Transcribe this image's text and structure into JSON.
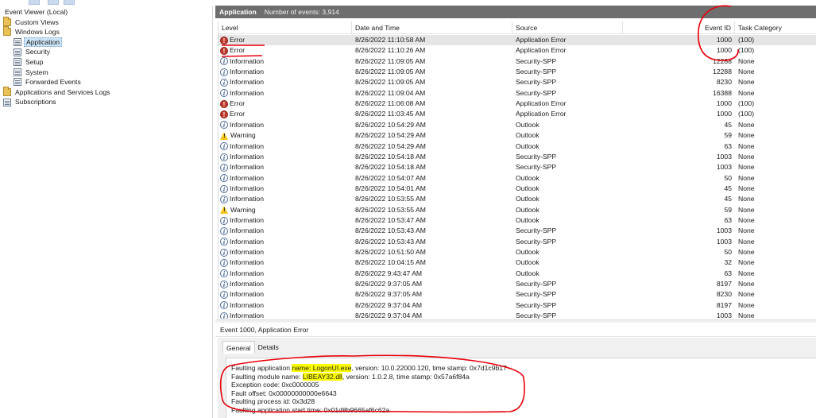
{
  "colors": {
    "header_bar": "#6e6e6e",
    "selection": "#cce4f7",
    "annotation": "#e8000a",
    "highlight": "#ffff00"
  },
  "tree": {
    "items": [
      {
        "label": "Event Viewer (Local)",
        "icon": "event-viewer-icon",
        "depth": 0
      },
      {
        "label": "Custom Views",
        "icon": "folder-icon",
        "depth": 1
      },
      {
        "label": "Windows Logs",
        "icon": "folder-icon",
        "depth": 1
      },
      {
        "label": "Application",
        "icon": "log-icon",
        "depth": 2,
        "selected": true
      },
      {
        "label": "Security",
        "icon": "log-icon",
        "depth": 2
      },
      {
        "label": "Setup",
        "icon": "log-icon",
        "depth": 2
      },
      {
        "label": "System",
        "icon": "log-icon",
        "depth": 2
      },
      {
        "label": "Forwarded Events",
        "icon": "log-icon",
        "depth": 2
      },
      {
        "label": "Applications and Services Logs",
        "icon": "folder-icon",
        "depth": 1
      },
      {
        "label": "Subscriptions",
        "icon": "log-icon",
        "depth": 1
      }
    ]
  },
  "header": {
    "title": "Application",
    "count": "Number of events: 3,914"
  },
  "columns": [
    "Level",
    "Date and Time",
    "Source",
    "Event ID",
    "Task Category"
  ],
  "events": [
    {
      "level": "Error",
      "icon": "error-icon",
      "date": "8/26/2022 11:10:58 AM",
      "source": "Application Error",
      "id": "1000",
      "task": "(100)",
      "selected": true
    },
    {
      "level": "Error",
      "icon": "error-icon",
      "date": "8/26/2022 11:10:26 AM",
      "source": "Application Error",
      "id": "1000",
      "task": "(100)"
    },
    {
      "level": "Information",
      "icon": "info-icon",
      "date": "8/26/2022 11:09:05 AM",
      "source": "Security-SPP",
      "id": "12288",
      "task": "None"
    },
    {
      "level": "Information",
      "icon": "info-icon",
      "date": "8/26/2022 11:09:05 AM",
      "source": "Security-SPP",
      "id": "12288",
      "task": "None"
    },
    {
      "level": "Information",
      "icon": "info-icon",
      "date": "8/26/2022 11:09:05 AM",
      "source": "Security-SPP",
      "id": "8230",
      "task": "None"
    },
    {
      "level": "Information",
      "icon": "info-icon",
      "date": "8/26/2022 11:09:04 AM",
      "source": "Security-SPP",
      "id": "16388",
      "task": "None"
    },
    {
      "level": "Error",
      "icon": "error-icon",
      "date": "8/26/2022 11:06:08 AM",
      "source": "Application Error",
      "id": "1000",
      "task": "(100)"
    },
    {
      "level": "Error",
      "icon": "error-icon",
      "date": "8/26/2022 11:03:45 AM",
      "source": "Application Error",
      "id": "1000",
      "task": "(100)"
    },
    {
      "level": "Information",
      "icon": "info-icon",
      "date": "8/26/2022 10:54:29 AM",
      "source": "Outlook",
      "id": "45",
      "task": "None"
    },
    {
      "level": "Warning",
      "icon": "warning-icon",
      "date": "8/26/2022 10:54:29 AM",
      "source": "Outlook",
      "id": "59",
      "task": "None"
    },
    {
      "level": "Information",
      "icon": "info-icon",
      "date": "8/26/2022 10:54:29 AM",
      "source": "Outlook",
      "id": "63",
      "task": "None"
    },
    {
      "level": "Information",
      "icon": "info-icon",
      "date": "8/26/2022 10:54:18 AM",
      "source": "Security-SPP",
      "id": "1003",
      "task": "None"
    },
    {
      "level": "Information",
      "icon": "info-icon",
      "date": "8/26/2022 10:54:18 AM",
      "source": "Security-SPP",
      "id": "1003",
      "task": "None"
    },
    {
      "level": "Information",
      "icon": "info-icon",
      "date": "8/26/2022 10:54:07 AM",
      "source": "Outlook",
      "id": "50",
      "task": "None"
    },
    {
      "level": "Information",
      "icon": "info-icon",
      "date": "8/26/2022 10:54:01 AM",
      "source": "Outlook",
      "id": "45",
      "task": "None"
    },
    {
      "level": "Information",
      "icon": "info-icon",
      "date": "8/26/2022 10:53:55 AM",
      "source": "Outlook",
      "id": "45",
      "task": "None"
    },
    {
      "level": "Warning",
      "icon": "warning-icon",
      "date": "8/26/2022 10:53:55 AM",
      "source": "Outlook",
      "id": "59",
      "task": "None"
    },
    {
      "level": "Information",
      "icon": "info-icon",
      "date": "8/26/2022 10:53:47 AM",
      "source": "Outlook",
      "id": "63",
      "task": "None"
    },
    {
      "level": "Information",
      "icon": "info-icon",
      "date": "8/26/2022 10:53:43 AM",
      "source": "Security-SPP",
      "id": "1003",
      "task": "None"
    },
    {
      "level": "Information",
      "icon": "info-icon",
      "date": "8/26/2022 10:53:43 AM",
      "source": "Security-SPP",
      "id": "1003",
      "task": "None"
    },
    {
      "level": "Information",
      "icon": "info-icon",
      "date": "8/26/2022 10:51:50 AM",
      "source": "Outlook",
      "id": "50",
      "task": "None"
    },
    {
      "level": "Information",
      "icon": "info-icon",
      "date": "8/26/2022 10:04:15 AM",
      "source": "Outlook",
      "id": "32",
      "task": "None"
    },
    {
      "level": "Information",
      "icon": "info-icon",
      "date": "8/26/2022 9:43:47 AM",
      "source": "Outlook",
      "id": "63",
      "task": "None"
    },
    {
      "level": "Information",
      "icon": "info-icon",
      "date": "8/26/2022 9:37:05 AM",
      "source": "Security-SPP",
      "id": "8197",
      "task": "None"
    },
    {
      "level": "Information",
      "icon": "info-icon",
      "date": "8/26/2022 9:37:05 AM",
      "source": "Security-SPP",
      "id": "8230",
      "task": "None"
    },
    {
      "level": "Information",
      "icon": "info-icon",
      "date": "8/26/2022 9:37:04 AM",
      "source": "Security-SPP",
      "id": "8197",
      "task": "None"
    },
    {
      "level": "Information",
      "icon": "info-icon",
      "date": "8/26/2022 9:37:04 AM",
      "source": "Security-SPP",
      "id": "1003",
      "task": "None"
    }
  ],
  "detail": {
    "title": "Event 1000, Application Error",
    "tabs": [
      "General",
      "Details"
    ],
    "active_tab": "General",
    "lines": [
      {
        "pre": "Faulting application ",
        "hl": "name: LogonUI.exe",
        "post": ", version: 10.0.22000.120, time stamp: 0x7d1c9b17"
      },
      {
        "pre": "Faulting module name: ",
        "hl": "LIBEAY32.dll",
        "post": ", version: 1.0.2.8, time stamp: 0x57a6f84a"
      },
      {
        "pre": "Exception code: 0xc0000005",
        "hl": "",
        "post": ""
      },
      {
        "pre": "Fault offset: 0x00000000000e6643",
        "hl": "",
        "post": ""
      },
      {
        "pre": "Faulting process id: 0x3d28",
        "hl": "",
        "post": ""
      },
      {
        "pre": "Faulting application start time: 0x01d8b9665af6c62a",
        "hl": "",
        "post": ""
      }
    ]
  }
}
